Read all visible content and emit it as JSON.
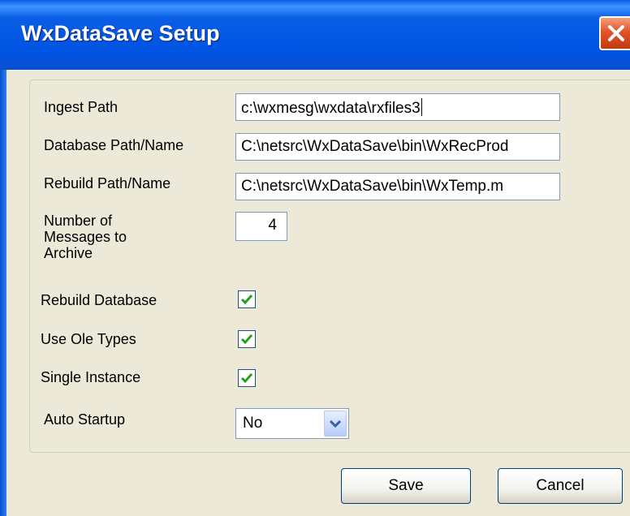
{
  "window": {
    "title": "WxDataSave Setup"
  },
  "form": {
    "ingest_path": {
      "label": "Ingest Path",
      "value": "c:\\wxmesg\\wxdata\\rxfiles3"
    },
    "database_path": {
      "label": "Database Path/Name",
      "value": "C:\\netsrc\\WxDataSave\\bin\\WxRecProd"
    },
    "rebuild_path": {
      "label": "Rebuild Path/Name",
      "value": "C:\\netsrc\\WxDataSave\\bin\\WxTemp.m"
    },
    "messages_to_archive": {
      "label": "Number of Messages  to Archive",
      "value": "4"
    },
    "rebuild_database": {
      "label": "Rebuild Database",
      "checked": true
    },
    "use_ole_types": {
      "label": "Use Ole Types",
      "checked": true
    },
    "single_instance": {
      "label": "Single Instance",
      "checked": true
    },
    "auto_startup": {
      "label": "Auto Startup",
      "value": "No"
    }
  },
  "buttons": {
    "save": "Save",
    "cancel": "Cancel"
  },
  "colors": {
    "titlebar": "#0054e3",
    "check": "#21a121",
    "close": "#e2542a"
  }
}
